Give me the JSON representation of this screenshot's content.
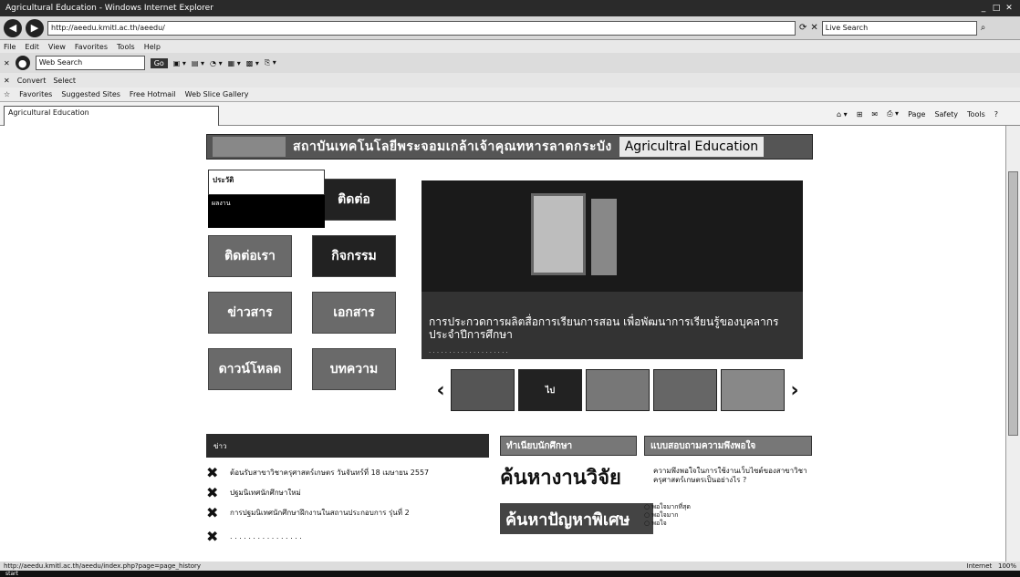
{
  "window": {
    "title": "Agricultural Education - Windows Internet Explorer"
  },
  "address": {
    "url": "http://aeedu.kmitl.ac.th/aeedu/",
    "search": "Live Search"
  },
  "menubar": [
    "File",
    "Edit",
    "View",
    "Favorites",
    "Tools",
    "Help"
  ],
  "toolbar": {
    "search_placeholder": "Web Search",
    "convert": "Convert",
    "select": "Select"
  },
  "favorites": {
    "label": "Favorites",
    "items": [
      "Suggested Sites",
      "Free Hotmail",
      "Web Slice Gallery"
    ]
  },
  "tab": {
    "title": "Agricultural Education"
  },
  "cmdbar": [
    "Page",
    "Safety",
    "Tools"
  ],
  "page": {
    "banner_thai": "สถาบันเทคโนโลยีพระจอมเกล้าเจ้าคุณทหารลาดกระบัง",
    "banner_en": "Agricultral Education",
    "menu_head": "ประวัติ",
    "tiles": [
      "ติดต่อ",
      "ติดต่อเรา",
      "กิจกรรม",
      "ข่าวสาร",
      "เอกสาร",
      "ดาวน์โหลด",
      "บทความ",
      "ผลงาน"
    ],
    "caption": "การประกวดการผลิตสื่อการเรียนการสอน เพื่อพัฒนาการเรียนรู้ของบุคลากร ประจำปีการศึกษา",
    "thumb_label": "ไป",
    "news_head": "ข่าว",
    "news": [
      "ต้อนรับสาขาวิชาครุศาสตร์เกษตร วันจันทร์ที่ 18 เมษายน 2557",
      "ปฐมนิเทศนักศึกษาใหม่",
      "การปฐมนิเทศนักศึกษาฝึกงานในสถานประกอบการ รุ่นที่ 2"
    ],
    "green_btns": [
      "ทำเนียบนักศึกษา",
      "แบบสอบถามความพึงพอใจ"
    ],
    "search1": "ค้นหางานวิจัย",
    "search2": "ค้นหาปัญหาพิเศษ",
    "poll": "ความพึงพอใจในการใช้งานเว็บไซต์ของสาขาวิชาครุศาสตร์เกษตรเป็นอย่างไร ?",
    "poll_options": [
      "พอใจมากที่สุด",
      "พอใจมาก",
      "พอใจ"
    ]
  },
  "status": {
    "url": "http://aeedu.kmitl.ac.th/aeedu/index.php?page=page_history",
    "zone": "Internet",
    "zoom": "100%"
  },
  "taskbar": {
    "start": "start"
  }
}
